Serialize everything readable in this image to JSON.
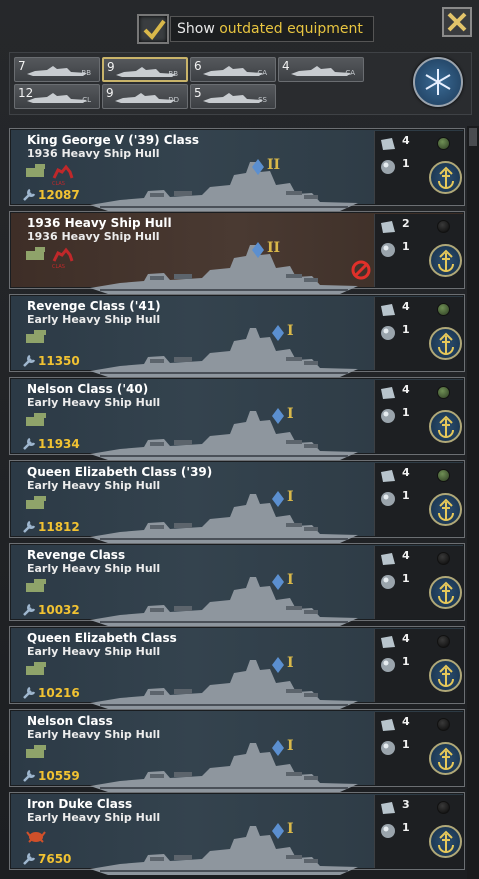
{
  "top": {
    "show_label": "Show",
    "show_highlight": "outdated equipment",
    "checked": true
  },
  "filters": [
    {
      "count": "7",
      "label": "BB"
    },
    {
      "count": "9",
      "label": "BB",
      "selected": true
    },
    {
      "count": "6",
      "label": "CA"
    },
    {
      "count": "4",
      "label": "CA"
    },
    {
      "count": "12",
      "label": "CL"
    },
    {
      "count": "9",
      "label": "DD"
    },
    {
      "count": "5",
      "label": "SS"
    }
  ],
  "designs": [
    {
      "title": "King George V ('39) Class",
      "hull": "1936 Heavy Ship Hull",
      "tier": "II",
      "cost": "12087",
      "armor": "4",
      "guns": "1",
      "style": "blue",
      "status": "green",
      "icon": "flag-icon"
    },
    {
      "title": "1936 Heavy Ship Hull",
      "hull": "1936 Heavy Ship Hull",
      "tier": "II",
      "cost": "",
      "armor": "2",
      "guns": "1",
      "style": "brown",
      "status": "black",
      "icon": "flag-icon"
    },
    {
      "title": "Revenge Class ('41)",
      "hull": "Early Heavy Ship Hull",
      "tier": "I",
      "cost": "11350",
      "armor": "4",
      "guns": "1",
      "style": "blue",
      "status": "green",
      "icon": "tank-icon"
    },
    {
      "title": "Nelson Class ('40)",
      "hull": "Early Heavy Ship Hull",
      "tier": "I",
      "cost": "11934",
      "armor": "4",
      "guns": "1",
      "style": "blue",
      "status": "green",
      "icon": "tank-icon"
    },
    {
      "title": "Queen Elizabeth Class ('39)",
      "hull": "Early Heavy Ship Hull",
      "tier": "I",
      "cost": "11812",
      "armor": "4",
      "guns": "1",
      "style": "blue",
      "status": "green",
      "icon": "tank-icon"
    },
    {
      "title": "Revenge Class",
      "hull": "Early Heavy Ship Hull",
      "tier": "I",
      "cost": "10032",
      "armor": "4",
      "guns": "1",
      "style": "blue",
      "status": "black",
      "icon": "tank-icon"
    },
    {
      "title": "Queen Elizabeth Class",
      "hull": "Early Heavy Ship Hull",
      "tier": "I",
      "cost": "10216",
      "armor": "4",
      "guns": "1",
      "style": "blue",
      "status": "black",
      "icon": "tank-icon"
    },
    {
      "title": "Nelson Class",
      "hull": "Early Heavy Ship Hull",
      "tier": "I",
      "cost": "10559",
      "armor": "4",
      "guns": "1",
      "style": "blue",
      "status": "black",
      "icon": "tank-icon"
    },
    {
      "title": "Iron Duke Class",
      "hull": "Early Heavy Ship Hull",
      "tier": "I",
      "cost": "7650",
      "armor": "3",
      "guns": "1",
      "style": "blue",
      "status": "black",
      "icon": "crab-icon"
    }
  ]
}
